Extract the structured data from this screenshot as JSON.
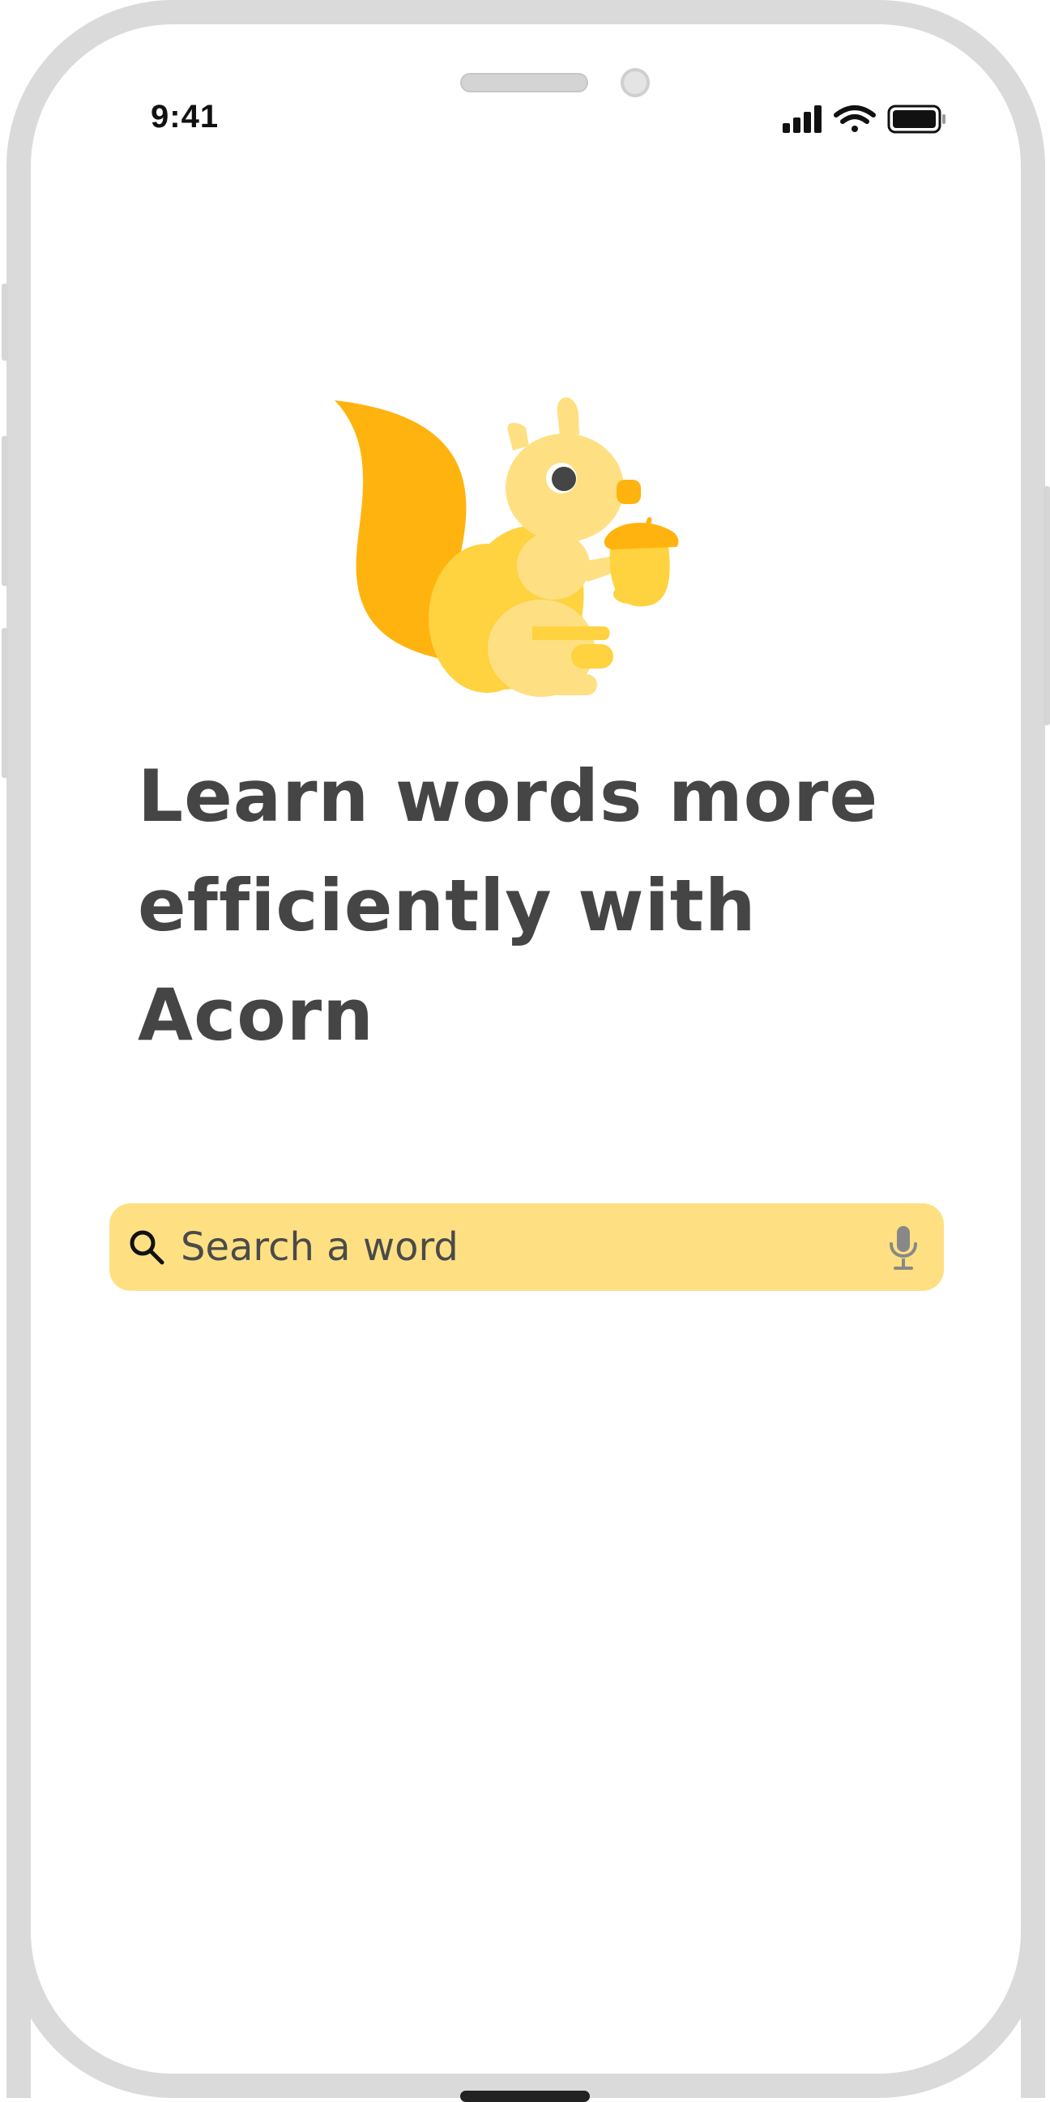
{
  "status_bar": {
    "time": "9:41",
    "icons": [
      "cellular-signal-icon",
      "wifi-icon",
      "battery-icon"
    ]
  },
  "hero": {
    "illustration": "squirrel-holding-acorn",
    "headline": "Learn words more efficiently with Acorn"
  },
  "search": {
    "placeholder": "Search a word",
    "value": "",
    "leading_icon": "search-icon",
    "trailing_icon": "microphone-icon"
  },
  "colors": {
    "accent": "#fee083",
    "tail": "#ffb30f",
    "body": "#ffd23f",
    "text": "#454545"
  }
}
